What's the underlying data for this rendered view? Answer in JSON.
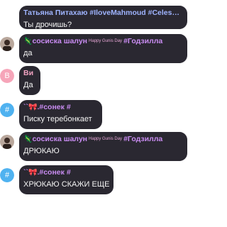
{
  "messages": [
    {
      "name": "Татьяна Питахаю #IloveMahmoud #Celes…",
      "name_color": "#9fb4ff",
      "text": "Ты дрочишь?",
      "avatar": "none"
    },
    {
      "name_emoji": "🦎",
      "name": "сосиска шалун",
      "name_tag": "Happy Gunis Day",
      "name_suffix": "#Годзилла",
      "name_color": "#c98cf2",
      "text": "да",
      "avatar": "photo"
    },
    {
      "name": "Ви",
      "name_color": "#f2a3c2",
      "text": "Да",
      "avatar": "letter",
      "avatar_letter": "В",
      "avatar_color": "#f6a5b9"
    },
    {
      "name_prefix": "``",
      "name_emoji": "🎀",
      "name": ".#сонек #",
      "name_color": "#c98cf2",
      "text": "Писку теребонкает",
      "avatar": "letter",
      "avatar_letter": "#",
      "avatar_color": "#4fb2f0"
    },
    {
      "name_emoji": "🦎",
      "name": "сосиска шалун",
      "name_tag": "Happy Gunis Day",
      "name_suffix": "#Годзилла",
      "name_color": "#c98cf2",
      "text": "ДРЮКАЮ",
      "avatar": "photo"
    },
    {
      "name_prefix": "``",
      "name_emoji": "🎀",
      "name": ".#сонек #",
      "name_color": "#c98cf2",
      "text": "ХРЮКАЮ СКАЖИ ЕЩЕ",
      "avatar": "letter",
      "avatar_letter": "#",
      "avatar_color": "#4fb2f0"
    }
  ]
}
